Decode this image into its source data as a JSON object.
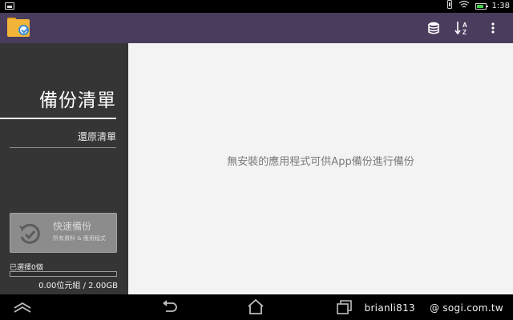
{
  "status_bar": {
    "time": "1:38",
    "icons": [
      "notification-icon",
      "vibrate-icon",
      "wifi-icon",
      "battery-icon"
    ],
    "battery_color": "#3fd14a"
  },
  "action_bar": {
    "background": "#4a3c5c",
    "app_icon": "folder-backup-icon",
    "actions": [
      "storage-icon",
      "sort-az-icon",
      "overflow-menu-icon"
    ]
  },
  "sidebar": {
    "title": "備份清單",
    "restore_item": "還原清單",
    "quick_backup": {
      "label": "快速備份",
      "sub": "所有資料 & 應用程式"
    },
    "selected_count": "已選擇0個",
    "storage_used_fraction": 0,
    "size_readout": "0.00位元組 / 2.00GB"
  },
  "main": {
    "empty_message": "無安裝的應用程式可供App備份進行備份"
  },
  "nav_bar": {
    "buttons": [
      "hide-keyboard-icon",
      "back-icon",
      "home-icon",
      "recents-icon"
    ],
    "watermark_user": "brianli813",
    "watermark_site": "@ sogi.com.tw"
  }
}
